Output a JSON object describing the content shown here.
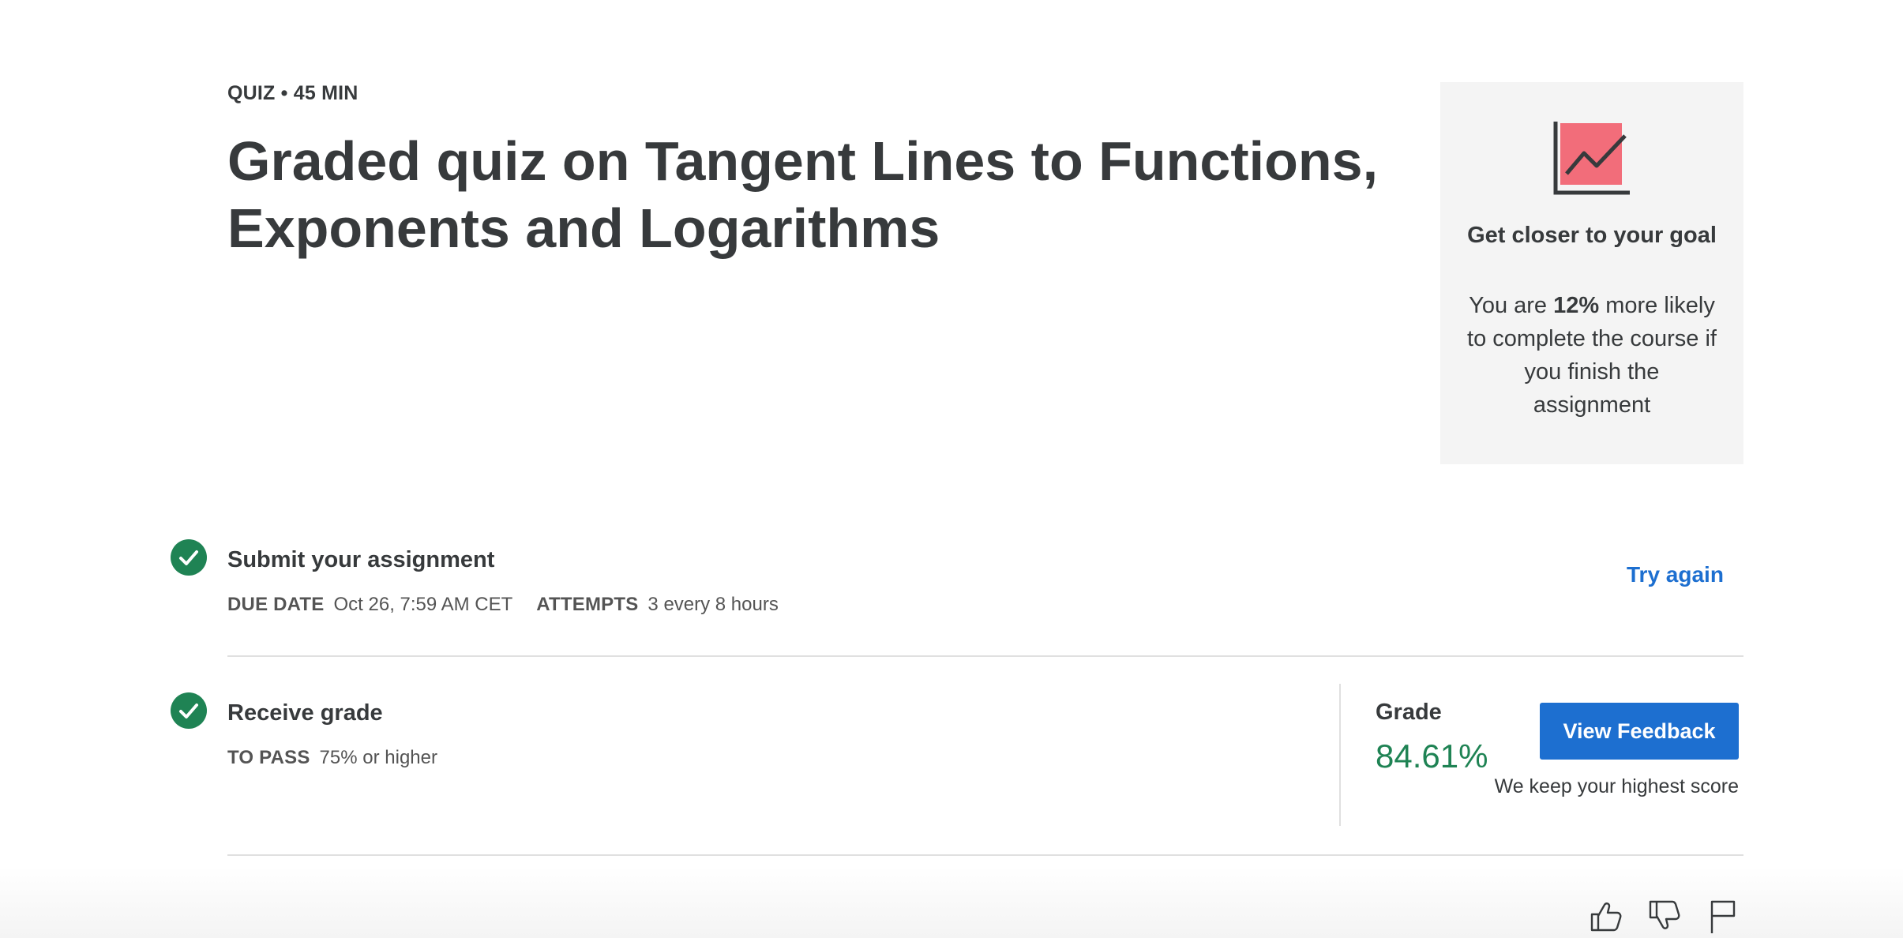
{
  "header": {
    "meta": "QUIZ • 45 MIN",
    "title": "Graded quiz on Tangent Lines to Functions, Exponents and Logarithms"
  },
  "goal_card": {
    "icon": "trending-chart-icon",
    "heading": "Get closer to your goal",
    "body_prefix": "You are ",
    "body_highlight": "12%",
    "body_suffix": " more likely to complete the course if you finish the assignment"
  },
  "submit_step": {
    "status_icon": "check-circle-icon",
    "title": "Submit your assignment",
    "due_label": "DUE DATE",
    "due_value": "Oct 26, 7:59 AM CET",
    "attempts_label": "ATTEMPTS",
    "attempts_value": "3 every 8 hours",
    "action_label": "Try again"
  },
  "grade_step": {
    "status_icon": "check-circle-icon",
    "title": "Receive grade",
    "pass_label": "TO PASS",
    "pass_value": "75% or higher",
    "grade_label": "Grade",
    "grade_value": "84.61%",
    "button_label": "View Feedback",
    "note": "We keep your highest score"
  },
  "feedback": {
    "icons": [
      "thumbs-up-icon",
      "thumbs-down-icon",
      "flag-icon"
    ]
  },
  "colors": {
    "accent": "#1d6fd0",
    "success": "#1f8354",
    "text": "#373a3c",
    "card_bg": "#f4f4f4",
    "icon_fill": "#f26d7a"
  }
}
